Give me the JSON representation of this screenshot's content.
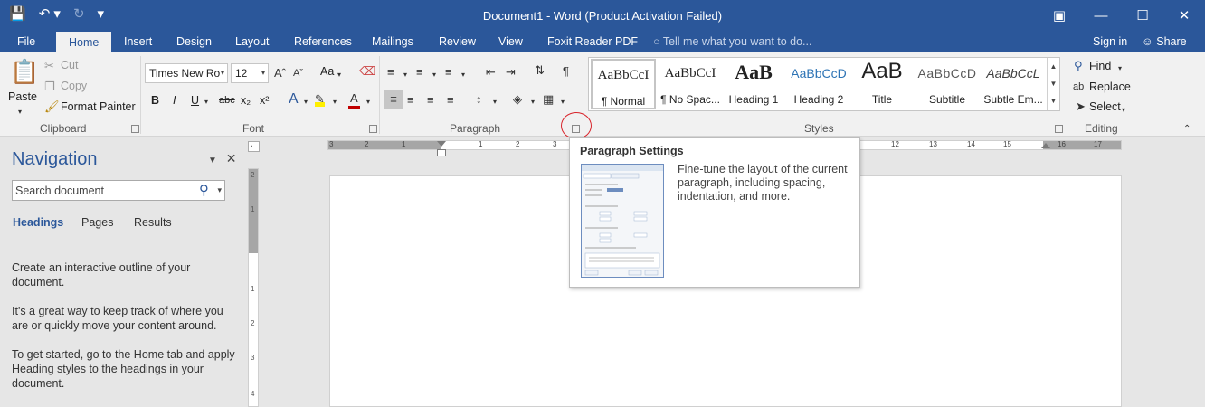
{
  "titlebar": {
    "title": "Document1 - Word (Product Activation Failed)",
    "qat_icons": [
      "save-icon",
      "undo-icon",
      "redo-icon",
      "customize-qat-icon"
    ],
    "window_icons": [
      "ribbon-display-icon",
      "minimize-icon",
      "restore-icon",
      "close-icon"
    ]
  },
  "tabs": {
    "items": [
      "File",
      "Home",
      "Insert",
      "Design",
      "Layout",
      "References",
      "Mailings",
      "Review",
      "View",
      "Foxit Reader PDF"
    ],
    "active": "Home",
    "tell_me": "Tell me what you want to do...",
    "sign_in": "Sign in",
    "share": "Share"
  },
  "clipboard": {
    "paste": "Paste",
    "cut": "Cut",
    "copy": "Copy",
    "format_painter": "Format Painter",
    "label": "Clipboard"
  },
  "font": {
    "name": "Times New Ro",
    "size": "12",
    "change_case": "Aa",
    "bold": "B",
    "italic": "I",
    "underline": "U",
    "strikethrough": "abc",
    "subscript": "x₂",
    "superscript": "x²",
    "label": "Font"
  },
  "paragraph": {
    "label": "Paragraph"
  },
  "styles": {
    "items": [
      {
        "sample": "AaBbCcI",
        "name": "¶ Normal"
      },
      {
        "sample": "AaBbCcI",
        "name": "¶ No Spac..."
      },
      {
        "sample": "AaB",
        "name": "Heading 1"
      },
      {
        "sample": "AaBbCcD",
        "name": "Heading 2"
      },
      {
        "sample": "AaB",
        "name": "Title"
      },
      {
        "sample": "AaBbCcD",
        "name": "Subtitle"
      },
      {
        "sample": "AaBbCcL",
        "name": "Subtle Em..."
      }
    ],
    "label": "Styles"
  },
  "editing": {
    "find": "Find",
    "replace": "Replace",
    "select": "Select",
    "label": "Editing"
  },
  "navigation": {
    "title": "Navigation",
    "search_placeholder": "Search document",
    "tabs": [
      "Headings",
      "Pages",
      "Results"
    ],
    "active_tab": "Headings",
    "paragraphs": [
      "Create an interactive outline of your document.",
      "It's a great way to keep track of where you are or quickly move your content around.",
      "To get started, go to the Home tab and apply Heading styles to the headings in your document."
    ]
  },
  "ruler": {
    "h_numbers": [
      "3",
      "2",
      "1",
      "1",
      "2",
      "3",
      "12",
      "13",
      "14",
      "15",
      "16",
      "17"
    ],
    "v_numbers": [
      "2",
      "1",
      "1",
      "2",
      "3",
      "4"
    ]
  },
  "tooltip": {
    "title": "Paragraph Settings",
    "description": "Fine-tune the layout of the current paragraph, including spacing, indentation, and more."
  },
  "colors": {
    "accent": "#2b579a",
    "ribbon": "#f1f1f1",
    "annotation": "#d8232a"
  }
}
